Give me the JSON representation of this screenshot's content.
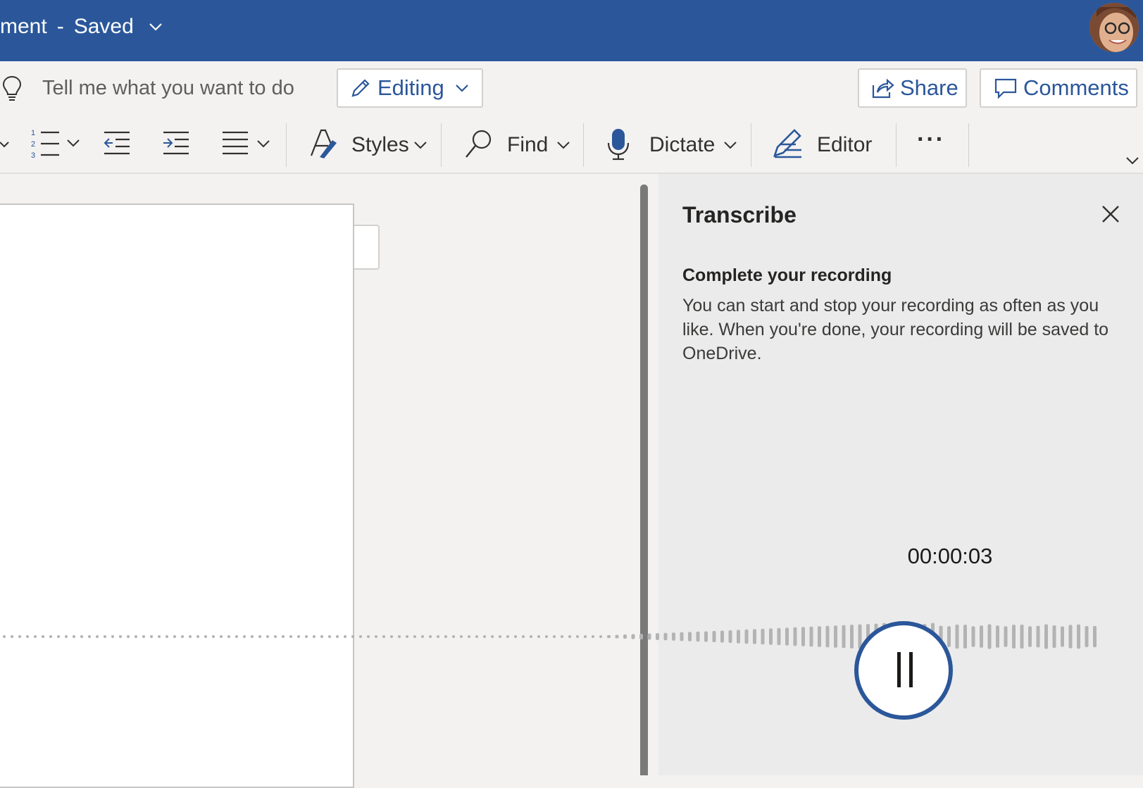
{
  "titlebar": {
    "doc_name": "ment",
    "separator": "-",
    "save_status": "Saved",
    "bg_color": "#2b579a"
  },
  "cmdbar": {
    "tellme_placeholder": "Tell me what you want to do",
    "editing_label": "Editing",
    "share_label": "Share",
    "comments_label": "Comments"
  },
  "ribbon": {
    "styles_label": "Styles",
    "find_label": "Find",
    "dictate_label": "Dictate",
    "editor_label": "Editor",
    "more_label": "···"
  },
  "transcribe": {
    "title": "Transcribe",
    "subtitle": "Complete your recording",
    "body": "You can start and stop your recording as often as you like. When you're done, your recording will be saved to OneDrive.",
    "timer": "00:00:03"
  },
  "icons": {
    "tellme": "lightbulb-icon",
    "editing": "pencil-icon",
    "share": "share-icon",
    "comments": "comment-icon",
    "numbering": "numbered-list-icon",
    "decrease_indent": "decrease-indent-icon",
    "increase_indent": "increase-indent-icon",
    "align": "align-icon",
    "styles": "styles-icon",
    "find": "search-icon",
    "dictate": "microphone-icon",
    "editor": "editor-pen-icon",
    "close": "close-icon",
    "pause": "pause-icon"
  }
}
